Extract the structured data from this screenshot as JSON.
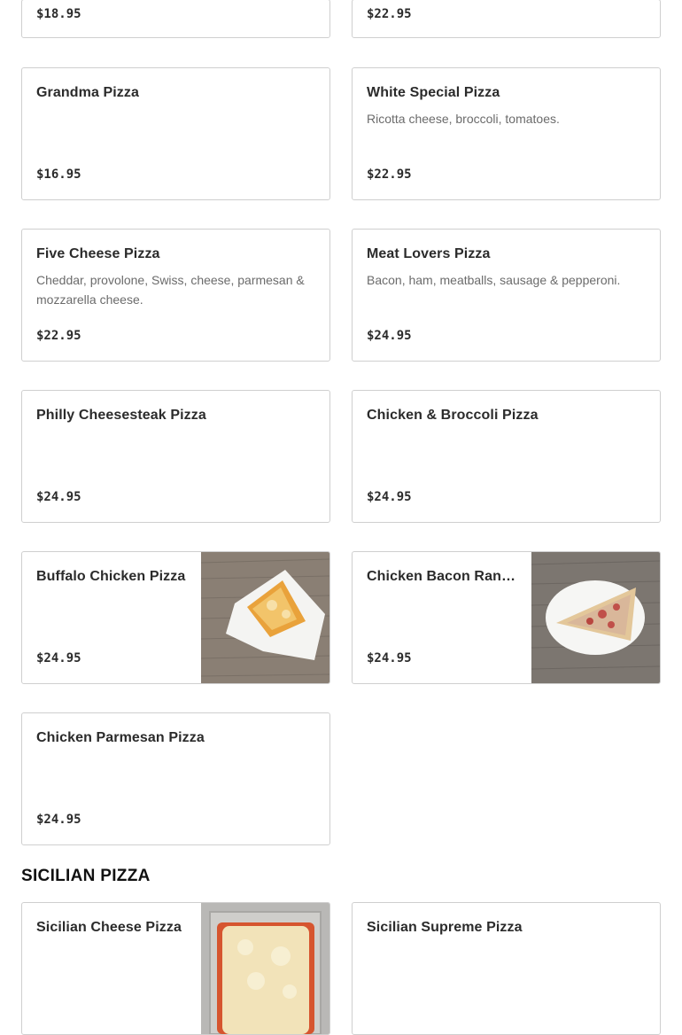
{
  "top_cards": [
    {
      "price": "$18.95"
    },
    {
      "price": "$22.95"
    }
  ],
  "items": [
    {
      "name": "Grandma Pizza",
      "desc": "",
      "price": "$16.95"
    },
    {
      "name": "White Special Pizza",
      "desc": "Ricotta cheese, broccoli, tomatoes.",
      "price": "$22.95"
    },
    {
      "name": "Five Cheese Pizza",
      "desc": "Cheddar, provolone, Swiss, cheese, parmesan & mozzarella cheese.",
      "price": "$22.95"
    },
    {
      "name": "Meat Lovers Pizza",
      "desc": "Bacon, ham, meatballs, sausage & pepperoni.",
      "price": "$24.95"
    },
    {
      "name": "Philly Cheesesteak Pizza",
      "desc": "",
      "price": "$24.95"
    },
    {
      "name": "Chicken & Broccoli Pizza",
      "desc": "",
      "price": "$24.95"
    },
    {
      "name": "Buffalo Chicken Pizza",
      "desc": "",
      "price": "$24.95"
    },
    {
      "name": "Chicken Bacon Ranch Pizza",
      "desc": "",
      "price": "$24.95"
    },
    {
      "name": "Chicken Parmesan Pizza",
      "desc": "",
      "price": "$24.95"
    }
  ],
  "sicilian": {
    "title": "SICILIAN PIZZA",
    "items": [
      {
        "name": "Sicilian Cheese Pizza"
      },
      {
        "name": "Sicilian Supreme Pizza"
      }
    ]
  }
}
